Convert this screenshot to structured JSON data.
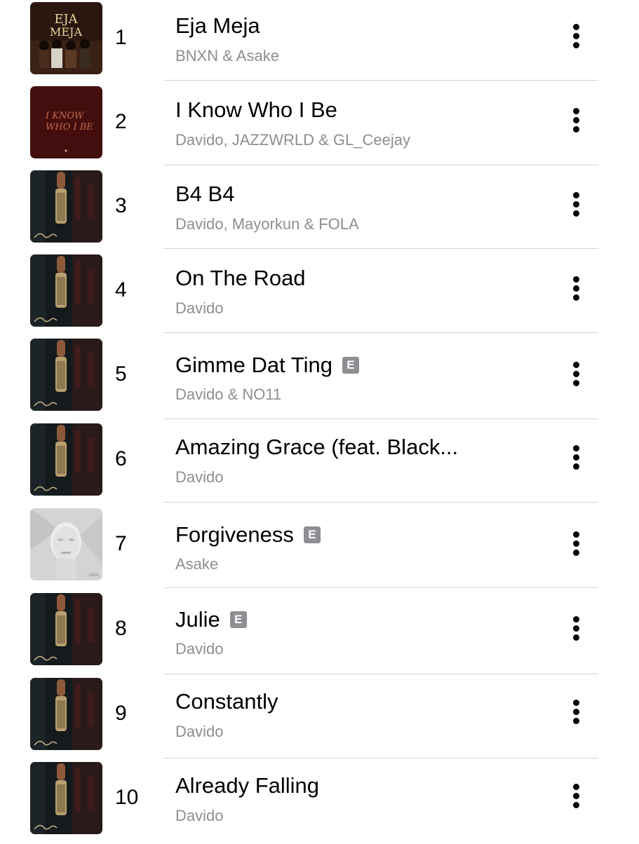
{
  "tracks": [
    {
      "rank": "1",
      "title": "Eja Meja",
      "artist": "BNXN & Asake",
      "explicit": false,
      "art": "eja-meja"
    },
    {
      "rank": "2",
      "title": "I Know Who I Be",
      "artist": "Davido, JAZZWRLD & GL_Ceejay",
      "explicit": false,
      "art": "i-know-who-i-be"
    },
    {
      "rank": "3",
      "title": "B4 B4",
      "artist": "Davido, Mayorkun & FOLA",
      "explicit": false,
      "art": "davido"
    },
    {
      "rank": "4",
      "title": "On The Road",
      "artist": "Davido",
      "explicit": false,
      "art": "davido"
    },
    {
      "rank": "5",
      "title": "Gimme Dat Ting",
      "artist": "Davido & NO11",
      "explicit": true,
      "art": "davido"
    },
    {
      "rank": "6",
      "title": "Amazing Grace (feat. Black...",
      "artist": "Davido",
      "explicit": false,
      "art": "davido"
    },
    {
      "rank": "7",
      "title": "Forgiveness",
      "artist": "Asake",
      "explicit": true,
      "art": "asake"
    },
    {
      "rank": "8",
      "title": "Julie",
      "artist": "Davido",
      "explicit": true,
      "art": "davido"
    },
    {
      "rank": "9",
      "title": "Constantly",
      "artist": "Davido",
      "explicit": false,
      "art": "davido"
    },
    {
      "rank": "10",
      "title": "Already Falling",
      "artist": "Davido",
      "explicit": false,
      "art": "davido"
    }
  ],
  "explicit_label": "E",
  "icons": {
    "more": "more-vertical-icon"
  },
  "colors": {
    "secondary_text": "#8e8e93",
    "explicit_badge": "#8e8e93",
    "separator": "#d4d4d8"
  }
}
